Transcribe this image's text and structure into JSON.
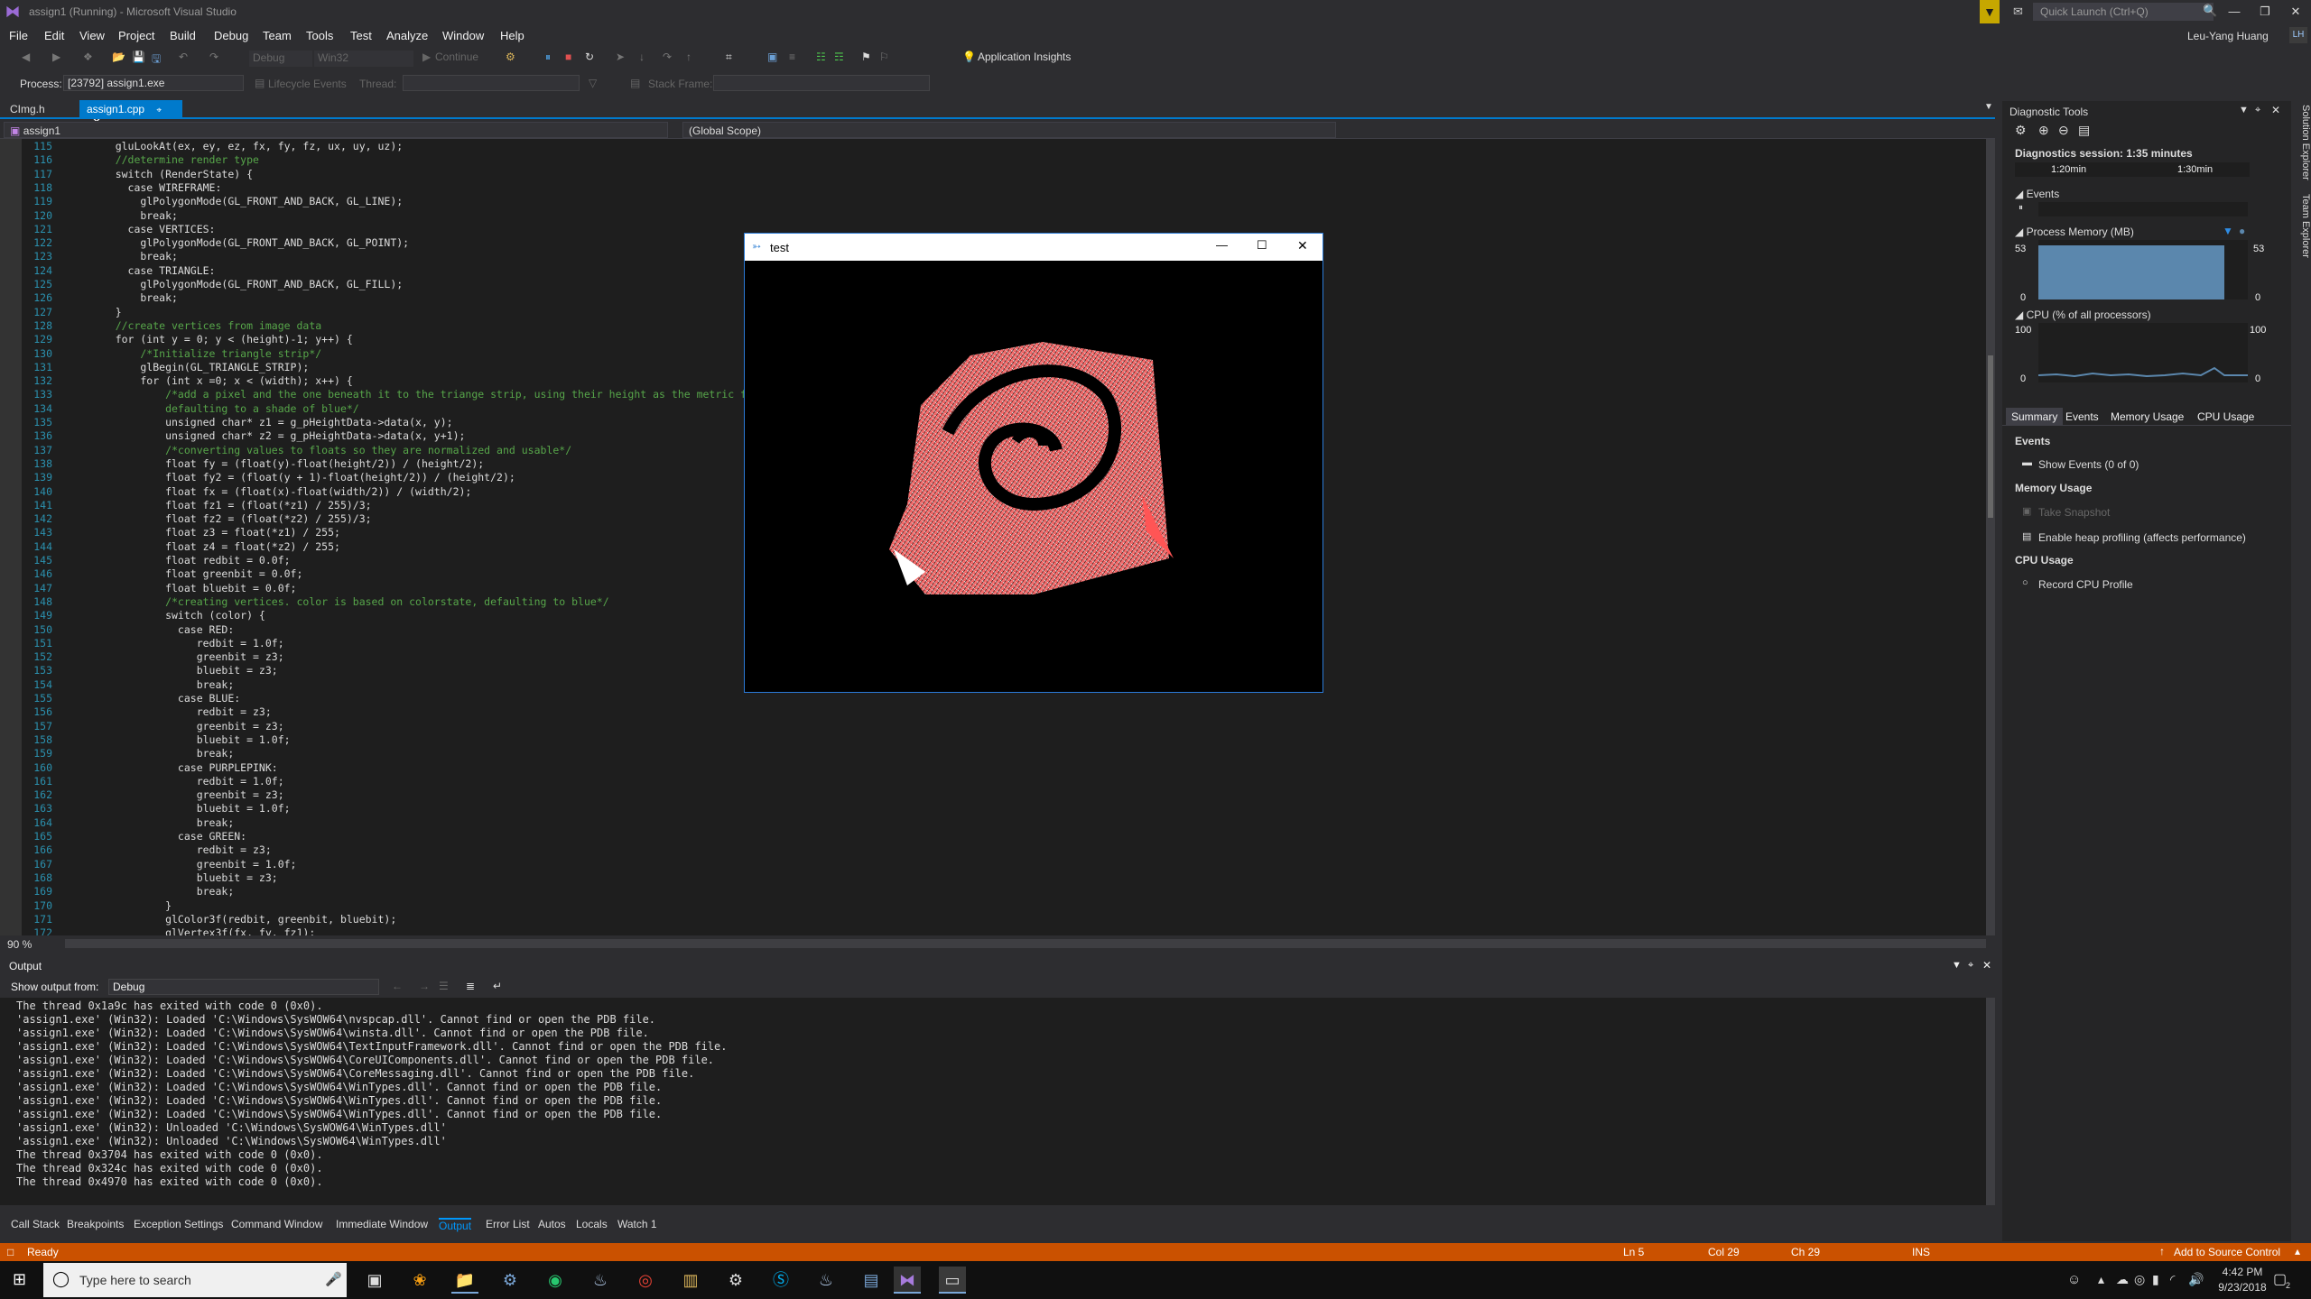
{
  "window": {
    "title": "assign1 (Running) - Microsoft Visual Studio",
    "quick_launch_placeholder": "Quick Launch (Ctrl+Q)",
    "user": "Leu-Yang Huang",
    "user_initials": "LH"
  },
  "menu": [
    "File",
    "Edit",
    "View",
    "Project",
    "Build",
    "Debug",
    "Team",
    "Tools",
    "Test",
    "Analyze",
    "Window",
    "Help"
  ],
  "toolbar": {
    "config": "Debug",
    "platform": "Win32",
    "continue_label": "Continue",
    "app_insights": "Application Insights"
  },
  "debugbar": {
    "process_label": "Process:",
    "process_value": "[23792] assign1.exe",
    "lifecycle_label": "Lifecycle Events",
    "thread_label": "Thread:",
    "stack_frame_label": "Stack Frame:"
  },
  "tabs": [
    {
      "label": "CImg.h"
    },
    {
      "label": "assign1.cpp"
    }
  ],
  "nav": {
    "project": "assign1",
    "scope": "(Global Scope)"
  },
  "code_lines": [
    {
      "n": "115",
      "t": "    gluLookAt(ex, ey, ez, fx, fy, fz, ux, uy, uz);",
      "c": ""
    },
    {
      "n": "116",
      "t": "    //determine render type",
      "c": "cmt"
    },
    {
      "n": "117",
      "t": "    switch (RenderState) {",
      "c": ""
    },
    {
      "n": "118",
      "t": "      case WIREFRAME:",
      "c": ""
    },
    {
      "n": "119",
      "t": "        glPolygonMode(GL_FRONT_AND_BACK, GL_LINE);",
      "c": ""
    },
    {
      "n": "120",
      "t": "        break;",
      "c": ""
    },
    {
      "n": "121",
      "t": "      case VERTICES:",
      "c": ""
    },
    {
      "n": "122",
      "t": "        glPolygonMode(GL_FRONT_AND_BACK, GL_POINT);",
      "c": ""
    },
    {
      "n": "123",
      "t": "        break;",
      "c": ""
    },
    {
      "n": "124",
      "t": "      case TRIANGLE:",
      "c": ""
    },
    {
      "n": "125",
      "t": "        glPolygonMode(GL_FRONT_AND_BACK, GL_FILL);",
      "c": ""
    },
    {
      "n": "126",
      "t": "        break;",
      "c": ""
    },
    {
      "n": "127",
      "t": "    }",
      "c": ""
    },
    {
      "n": "128",
      "t": "    //create vertices from image data",
      "c": "cmt"
    },
    {
      "n": "129",
      "t": "    for (int y = 0; y < (height)-1; y++) {",
      "c": ""
    },
    {
      "n": "130",
      "t": "        /*Initialize triangle strip*/",
      "c": "cmt"
    },
    {
      "n": "131",
      "t": "        glBegin(GL_TRIANGLE_STRIP);",
      "c": ""
    },
    {
      "n": "132",
      "t": "        for (int x =0; x < (width); x++) {",
      "c": ""
    },
    {
      "n": "133",
      "t": "            /*add a pixel and the one beneath it to the triange strip, using their height as the metric for the color",
      "c": "cmt"
    },
    {
      "n": "134",
      "t": "            defaulting to a shade of blue*/",
      "c": "cmt"
    },
    {
      "n": "135",
      "t": "            unsigned char* z1 = g_pHeightData->data(x, y);",
      "c": ""
    },
    {
      "n": "136",
      "t": "            unsigned char* z2 = g_pHeightData->data(x, y+1);",
      "c": ""
    },
    {
      "n": "137",
      "t": "            /*converting values to floats so they are normalized and usable*/",
      "c": "cmt"
    },
    {
      "n": "138",
      "t": "            float fy = (float(y)-float(height/2)) / (height/2);",
      "c": ""
    },
    {
      "n": "139",
      "t": "            float fy2 = (float(y + 1)-float(height/2)) / (height/2);",
      "c": ""
    },
    {
      "n": "140",
      "t": "            float fx = (float(x)-float(width/2)) / (width/2);",
      "c": ""
    },
    {
      "n": "141",
      "t": "            float fz1 = (float(*z1) / 255)/3;",
      "c": ""
    },
    {
      "n": "142",
      "t": "            float fz2 = (float(*z2) / 255)/3;",
      "c": ""
    },
    {
      "n": "143",
      "t": "            float z3 = float(*z1) / 255;",
      "c": ""
    },
    {
      "n": "144",
      "t": "            float z4 = float(*z2) / 255;",
      "c": ""
    },
    {
      "n": "145",
      "t": "            float redbit = 0.0f;",
      "c": ""
    },
    {
      "n": "146",
      "t": "            float greenbit = 0.0f;",
      "c": ""
    },
    {
      "n": "147",
      "t": "            float bluebit = 0.0f;",
      "c": ""
    },
    {
      "n": "148",
      "t": "            /*creating vertices. color is based on colorstate, defaulting to blue*/",
      "c": "cmt"
    },
    {
      "n": "149",
      "t": "            switch (color) {",
      "c": ""
    },
    {
      "n": "150",
      "t": "              case RED:",
      "c": ""
    },
    {
      "n": "151",
      "t": "                 redbit = 1.0f;",
      "c": ""
    },
    {
      "n": "152",
      "t": "                 greenbit = z3;",
      "c": ""
    },
    {
      "n": "153",
      "t": "                 bluebit = z3;",
      "c": ""
    },
    {
      "n": "154",
      "t": "                 break;",
      "c": ""
    },
    {
      "n": "155",
      "t": "              case BLUE:",
      "c": ""
    },
    {
      "n": "156",
      "t": "                 redbit = z3;",
      "c": ""
    },
    {
      "n": "157",
      "t": "                 greenbit = z3;",
      "c": ""
    },
    {
      "n": "158",
      "t": "                 bluebit = 1.0f;",
      "c": ""
    },
    {
      "n": "159",
      "t": "                 break;",
      "c": ""
    },
    {
      "n": "160",
      "t": "              case PURPLEPINK:",
      "c": ""
    },
    {
      "n": "161",
      "t": "                 redbit = 1.0f;",
      "c": ""
    },
    {
      "n": "162",
      "t": "                 greenbit = z3;",
      "c": ""
    },
    {
      "n": "163",
      "t": "                 bluebit = 1.0f;",
      "c": ""
    },
    {
      "n": "164",
      "t": "                 break;",
      "c": ""
    },
    {
      "n": "165",
      "t": "              case GREEN:",
      "c": ""
    },
    {
      "n": "166",
      "t": "                 redbit = z3;",
      "c": ""
    },
    {
      "n": "167",
      "t": "                 greenbit = 1.0f;",
      "c": ""
    },
    {
      "n": "168",
      "t": "                 bluebit = z3;",
      "c": ""
    },
    {
      "n": "169",
      "t": "                 break;",
      "c": ""
    },
    {
      "n": "170",
      "t": "            }",
      "c": ""
    },
    {
      "n": "171",
      "t": "            glColor3f(redbit, greenbit, bluebit);",
      "c": ""
    },
    {
      "n": "172",
      "t": "            glVertex3f(fx, fy, fz1);",
      "c": ""
    }
  ],
  "editor": {
    "zoom": "90 %"
  },
  "diagnostics": {
    "title": "Diagnostic Tools",
    "session": "Diagnostics session: 1:35 minutes",
    "t1": "1:20min",
    "t2": "1:30min",
    "events_label": "Events",
    "mem_label": "Process Memory (MB)",
    "mem_max": "53",
    "mem_min": "0",
    "cpu_label": "CPU (% of all processors)",
    "cpu_max": "100",
    "cpu_min": "0",
    "tabs": [
      "Summary",
      "Events",
      "Memory Usage",
      "CPU Usage"
    ],
    "sec_events": "Events",
    "show_events": "Show Events (0 of 0)",
    "sec_memory": "Memory Usage",
    "take_snapshot": "Take Snapshot",
    "heap_profiling": "Enable heap profiling (affects performance)",
    "sec_cpu": "CPU Usage",
    "record_cpu": "Record CPU Profile",
    "side_tabs": [
      "Solution Explorer",
      "Team Explorer"
    ]
  },
  "output": {
    "title": "Output",
    "show_from_label": "Show output from:",
    "show_from_value": "Debug",
    "lines": [
      "The thread 0x1a9c has exited with code 0 (0x0).",
      "'assign1.exe' (Win32): Loaded 'C:\\Windows\\SysWOW64\\nvspcap.dll'. Cannot find or open the PDB file.",
      "'assign1.exe' (Win32): Loaded 'C:\\Windows\\SysWOW64\\winsta.dll'. Cannot find or open the PDB file.",
      "'assign1.exe' (Win32): Loaded 'C:\\Windows\\SysWOW64\\TextInputFramework.dll'. Cannot find or open the PDB file.",
      "'assign1.exe' (Win32): Loaded 'C:\\Windows\\SysWOW64\\CoreUIComponents.dll'. Cannot find or open the PDB file.",
      "'assign1.exe' (Win32): Loaded 'C:\\Windows\\SysWOW64\\CoreMessaging.dll'. Cannot find or open the PDB file.",
      "'assign1.exe' (Win32): Loaded 'C:\\Windows\\SysWOW64\\WinTypes.dll'. Cannot find or open the PDB file.",
      "'assign1.exe' (Win32): Loaded 'C:\\Windows\\SysWOW64\\WinTypes.dll'. Cannot find or open the PDB file.",
      "'assign1.exe' (Win32): Loaded 'C:\\Windows\\SysWOW64\\WinTypes.dll'. Cannot find or open the PDB file.",
      "'assign1.exe' (Win32): Unloaded 'C:\\Windows\\SysWOW64\\WinTypes.dll'",
      "'assign1.exe' (Win32): Unloaded 'C:\\Windows\\SysWOW64\\WinTypes.dll'",
      "The thread 0x3704 has exited with code 0 (0x0).",
      "The thread 0x324c has exited with code 0 (0x0).",
      "The thread 0x4970 has exited with code 0 (0x0)."
    ]
  },
  "bottom_tabs": [
    "Call Stack",
    "Breakpoints",
    "Exception Settings",
    "Command Window",
    "Immediate Window",
    "Output",
    "Error List",
    "Autos",
    "Locals",
    "Watch 1"
  ],
  "status": {
    "ready": "Ready",
    "ln": "Ln 5",
    "col": "Col 29",
    "ch": "Ch 29",
    "ins": "INS",
    "source_control": "Add to Source Control"
  },
  "taskbar": {
    "search_placeholder": "Type here to search",
    "time": "4:42 PM",
    "date": "9/23/2018",
    "notif_count": "2"
  },
  "test_window": {
    "title": "test"
  },
  "colors": {
    "accent": "#007acc",
    "status": "#ca5100",
    "editor_bg": "#1e1e1e",
    "chrome": "#2d2d30"
  }
}
